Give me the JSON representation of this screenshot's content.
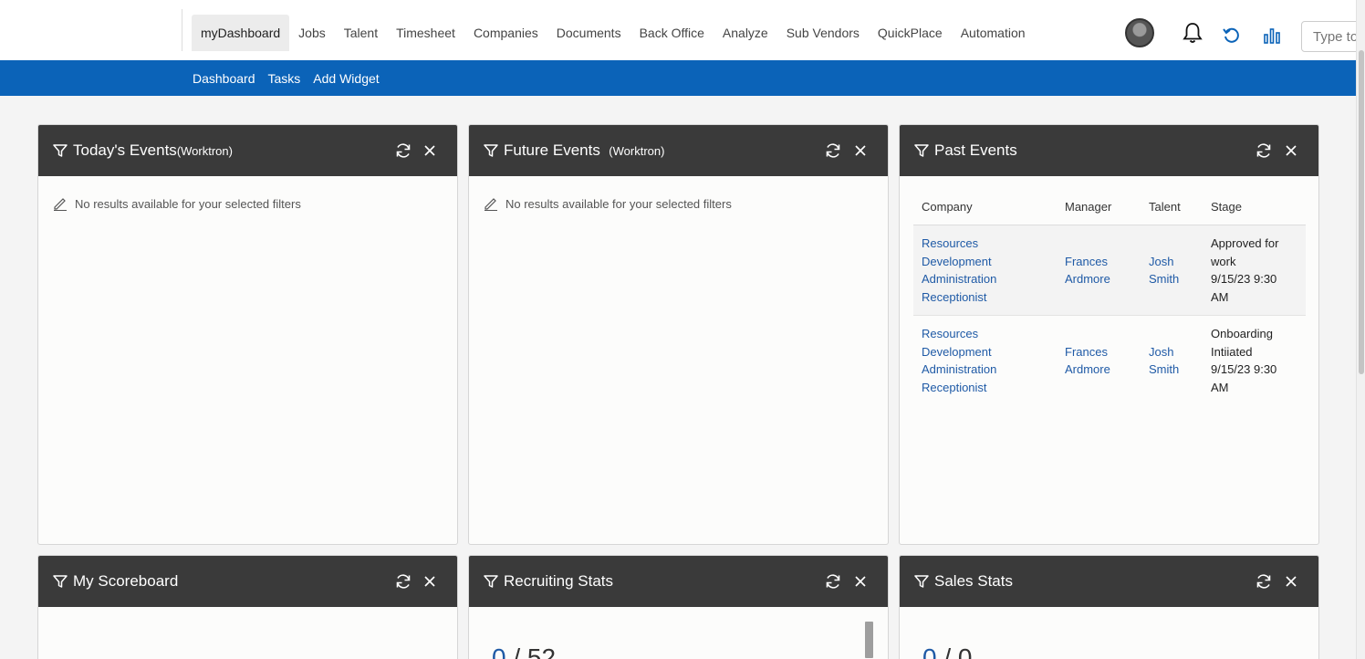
{
  "nav": {
    "items": [
      "myDashboard",
      "Jobs",
      "Talent",
      "Timesheet",
      "Companies",
      "Documents",
      "Back Office",
      "Analyze",
      "Sub Vendors",
      "QuickPlace",
      "Automation"
    ],
    "active": "myDashboard"
  },
  "search": {
    "placeholder": "Type to"
  },
  "subnav": {
    "items": [
      "Dashboard",
      "Tasks",
      "Add Widget"
    ]
  },
  "icons": [
    "filter-icon",
    "refresh-icon",
    "close-icon",
    "bell-icon",
    "history-icon",
    "chart-icon",
    "pencil-icon"
  ],
  "widgets": {
    "today": {
      "title": "Today's Events",
      "suffix": "(Worktron)",
      "empty": "No results available for your selected filters"
    },
    "future": {
      "title": "Future Events",
      "suffix": "(Worktron)",
      "empty": "No results available for your selected filters"
    },
    "past": {
      "title": "Past Events",
      "columns": [
        "Company",
        "Manager",
        "Talent",
        "Stage"
      ],
      "rows": [
        {
          "company": "Resources Development Administration Receptionist",
          "manager": "Frances Ardmore",
          "talent": "Josh Smith",
          "stage": "Approved for work",
          "date": "9/15/23 9:30 AM"
        },
        {
          "company": "Resources Development Administration Receptionist",
          "manager": "Frances Ardmore",
          "talent": "Josh Smith",
          "stage": "Onboarding Intiiated",
          "date": "9/15/23 9:30 AM"
        }
      ]
    },
    "scoreboard": {
      "title": "My Scoreboard"
    },
    "recruiting": {
      "title": "Recruiting Stats",
      "value": "0",
      "sep": " / ",
      "total": "52"
    },
    "sales": {
      "title": "Sales Stats",
      "value": "0",
      "sep": " / ",
      "total": "0"
    }
  },
  "colors": {
    "brand": "#0b63b8",
    "widget_header": "#3a3a3a",
    "link": "#1f5aa6"
  }
}
